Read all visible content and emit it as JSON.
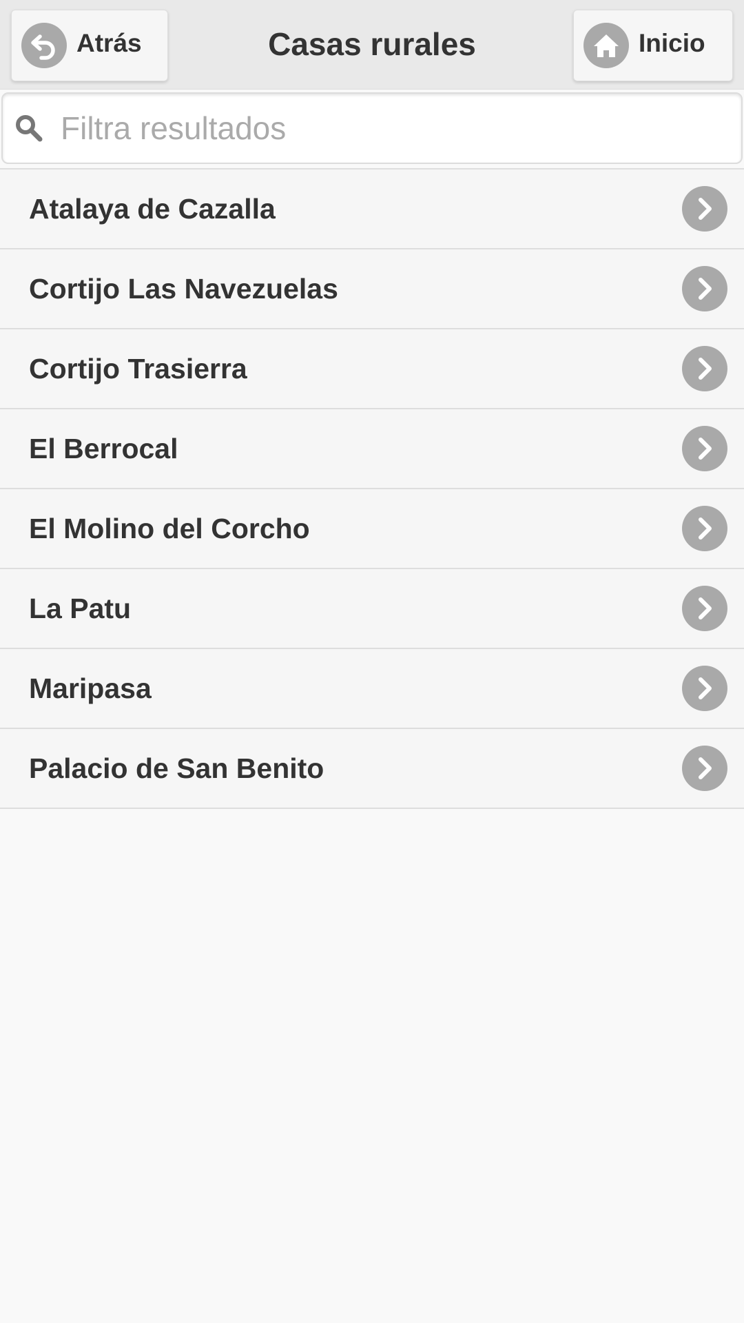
{
  "header": {
    "title": "Casas rurales",
    "back_label": "Atrás",
    "back_icon": "back-arrow-icon",
    "home_label": "Inicio",
    "home_icon": "home-icon"
  },
  "search": {
    "placeholder": "Filtra resultados",
    "value": "",
    "icon": "search-icon"
  },
  "list": {
    "items": [
      {
        "label": "Atalaya de Cazalla"
      },
      {
        "label": "Cortijo Las Navezuelas"
      },
      {
        "label": "Cortijo Trasierra"
      },
      {
        "label": "El Berrocal"
      },
      {
        "label": "El Molino del Corcho"
      },
      {
        "label": "La Patu"
      },
      {
        "label": "Maripasa"
      },
      {
        "label": "Palacio de San Benito"
      }
    ],
    "item_icon": "chevron-right-icon"
  },
  "colors": {
    "header_bg": "#e9e9e9",
    "page_bg": "#f9f9f9",
    "icon_disc": "#a9a9a9",
    "text": "#333333",
    "placeholder": "#aaaaaa"
  }
}
